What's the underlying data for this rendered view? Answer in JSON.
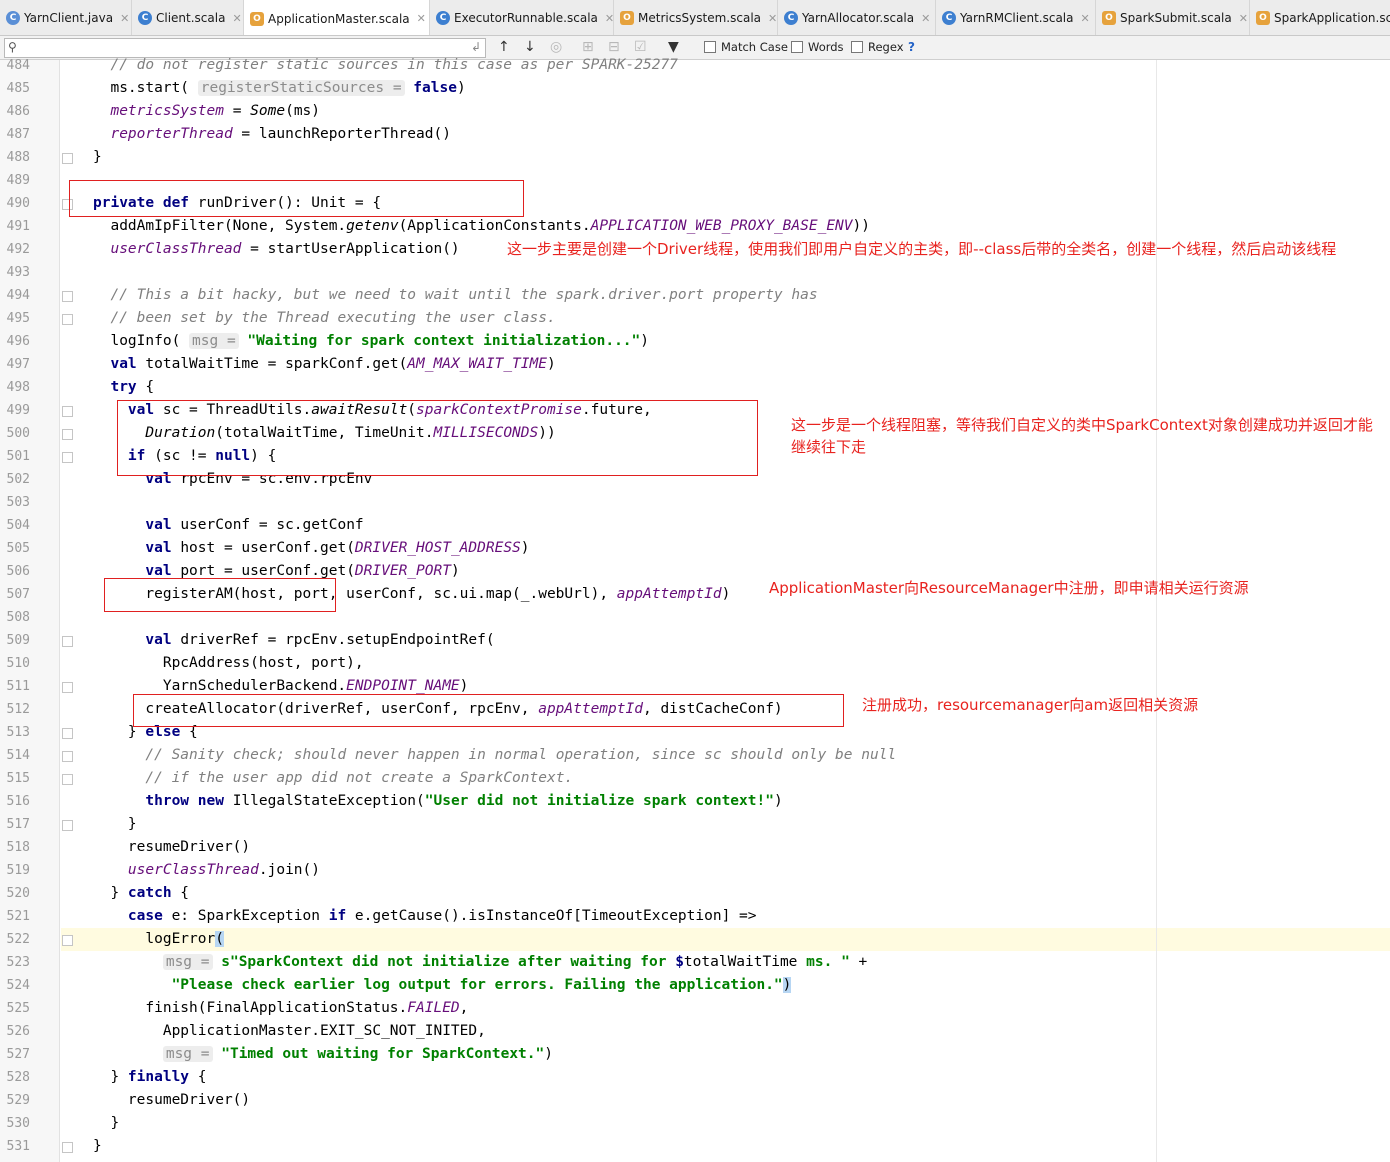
{
  "tabs": [
    {
      "label": "YarnClient.java",
      "icon": "java-class-icon",
      "active": false
    },
    {
      "label": "Client.scala",
      "icon": "scala-class-icon",
      "active": false
    },
    {
      "label": "ApplicationMaster.scala",
      "icon": "scala-object-icon",
      "active": true
    },
    {
      "label": "ExecutorRunnable.scala",
      "icon": "scala-class-icon",
      "active": false
    },
    {
      "label": "MetricsSystem.scala",
      "icon": "scala-object-icon",
      "active": false
    },
    {
      "label": "YarnAllocator.scala",
      "icon": "scala-class-icon",
      "active": false
    },
    {
      "label": "YarnRMClient.scala",
      "icon": "scala-class-icon",
      "active": false
    },
    {
      "label": "SparkSubmit.scala",
      "icon": "scala-object-icon",
      "active": false
    },
    {
      "label": "SparkApplication.sca",
      "icon": "scala-object-icon",
      "active": false
    }
  ],
  "search": {
    "value": "",
    "placeholder": "",
    "options": {
      "match_case": "Match Case",
      "words": "Words",
      "regex": "Regex",
      "help": "?"
    }
  },
  "editor": {
    "caret_line": "522",
    "lines": [
      {
        "n": "484",
        "html": "  <span class=\"cm\">// do not register static sources in this case as per SPARK-25277</span>"
      },
      {
        "n": "485",
        "html": "  ms.start( <span class=\"hint\">registerStaticSources =</span> <span class=\"kw\">false</span>)"
      },
      {
        "n": "486",
        "html": "  <span class=\"fld\">metricsSystem</span> = <span class=\"it\">Some</span>(ms)"
      },
      {
        "n": "487",
        "html": "  <span class=\"fld\">reporterThread</span> = launchReporterThread()"
      },
      {
        "n": "488",
        "html": "}",
        "fold": true
      },
      {
        "n": "489",
        "html": ""
      },
      {
        "n": "490",
        "html": "<span class=\"kw\">private def</span> runDriver(): Unit = {",
        "fold": true
      },
      {
        "n": "491",
        "html": "  addAmIpFilter(None, System.<span class=\"it\">getenv</span>(ApplicationConstants.<span class=\"fld\">APPLICATION_WEB_PROXY_BASE_ENV</span>))"
      },
      {
        "n": "492",
        "html": "  <span class=\"fld\">userClassThread</span> = startUserApplication()"
      },
      {
        "n": "493",
        "html": ""
      },
      {
        "n": "494",
        "html": "  <span class=\"cm\">// This a bit hacky, but we need to wait until the spark.driver.port property has</span>",
        "fold": true
      },
      {
        "n": "495",
        "html": "  <span class=\"cm\">// been set by the Thread executing the user class.</span>",
        "fold": true
      },
      {
        "n": "496",
        "html": "  logInfo( <span class=\"hint\">msg =</span> <span class=\"str\">\"Waiting for spark context initialization...\"</span>)"
      },
      {
        "n": "497",
        "html": "  <span class=\"kw\">val</span> totalWaitTime = sparkConf.get(<span class=\"fld\">AM_MAX_WAIT_TIME</span>)"
      },
      {
        "n": "498",
        "html": "  <span class=\"kw\">try</span> {"
      },
      {
        "n": "499",
        "html": "    <span class=\"kw\">val</span> sc = ThreadUtils.<span class=\"it\">awaitResult</span>(<span class=\"fld\">sparkContextPromise</span>.future,",
        "fold": true
      },
      {
        "n": "500",
        "html": "      <span class=\"it\">Duration</span>(totalWaitTime, TimeUnit.<span class=\"fld\">MILLISECONDS</span>))",
        "fold": true
      },
      {
        "n": "501",
        "html": "    <span class=\"kw\">if</span> (sc != <span class=\"kw\">null</span>) {",
        "fold": true
      },
      {
        "n": "502",
        "html": "      <span class=\"kw\">val</span> rpcEnv = sc.env.rpcEnv"
      },
      {
        "n": "503",
        "html": ""
      },
      {
        "n": "504",
        "html": "      <span class=\"kw\">val</span> userConf = sc.getConf"
      },
      {
        "n": "505",
        "html": "      <span class=\"kw\">val</span> host = userConf.get(<span class=\"fld\">DRIVER_HOST_ADDRESS</span>)"
      },
      {
        "n": "506",
        "html": "      <span class=\"kw\">val</span> port = userConf.get(<span class=\"fld\">DRIVER_PORT</span>)"
      },
      {
        "n": "507",
        "html": "      registerAM(host, port, userConf, sc.ui.map(_.webUrl), <span class=\"fld\">appAttemptId</span>)"
      },
      {
        "n": "508",
        "html": ""
      },
      {
        "n": "509",
        "html": "      <span class=\"kw\">val</span> driverRef = rpcEnv.setupEndpointRef(",
        "fold": true
      },
      {
        "n": "510",
        "html": "        RpcAddress(host, port),"
      },
      {
        "n": "511",
        "html": "        YarnSchedulerBackend.<span class=\"fld\">ENDPOINT_NAME</span>)",
        "fold": true
      },
      {
        "n": "512",
        "html": "      createAllocator(driverRef, userConf, rpcEnv, <span class=\"fld\">appAttemptId</span>, distCacheConf)"
      },
      {
        "n": "513",
        "html": "    } <span class=\"kw\">else</span> {",
        "fold": true
      },
      {
        "n": "514",
        "html": "      <span class=\"cm\">// Sanity check; should never happen in normal operation, since sc should only be null</span>",
        "fold": true
      },
      {
        "n": "515",
        "html": "      <span class=\"cm\">// if the user app did not create a SparkContext.</span>",
        "fold": true
      },
      {
        "n": "516",
        "html": "      <span class=\"kw\">throw new</span> IllegalStateException(<span class=\"str\">\"User did not initialize spark context!\"</span>)"
      },
      {
        "n": "517",
        "html": "    }",
        "fold": true
      },
      {
        "n": "518",
        "html": "    resumeDriver()"
      },
      {
        "n": "519",
        "html": "    <span class=\"fld\">userClassThread</span>.join()"
      },
      {
        "n": "520",
        "html": "  } <span class=\"kw\">catch</span> {"
      },
      {
        "n": "521",
        "html": "    <span class=\"kw\">case</span> e: SparkException <span class=\"kw\">if</span> e.getCause().isInstanceOf[TimeoutException] =&gt;"
      },
      {
        "n": "522",
        "html": "      logError<span class=\"bracket-hl\">(</span>",
        "fold": true
      },
      {
        "n": "523",
        "html": "        <span class=\"hint\">msg =</span> <span class=\"str\">s\"SparkContext did not initialize after waiting for </span><span class=\"kw\">$</span>totalWaitTime<span class=\"str\"> ms. \"</span> +"
      },
      {
        "n": "524",
        "html": "         <span class=\"str\">\"Please check earlier log output for errors. Failing the application.\"</span><span class=\"bracket-hl\">)</span>"
      },
      {
        "n": "525",
        "html": "      finish(FinalApplicationStatus.<span class=\"fld\">FAILED</span>,"
      },
      {
        "n": "526",
        "html": "        ApplicationMaster.EXIT_SC_NOT_INITED,"
      },
      {
        "n": "527",
        "html": "        <span class=\"hint\">msg =</span> <span class=\"str\">\"Timed out waiting for SparkContext.\"</span>)"
      },
      {
        "n": "528",
        "html": "  } <span class=\"kw\">finally</span> {"
      },
      {
        "n": "529",
        "html": "    resumeDriver()"
      },
      {
        "n": "530",
        "html": "  }"
      },
      {
        "n": "531",
        "html": "}",
        "fold": true
      }
    ]
  },
  "annotations": [
    {
      "id": "note-create-driver-thread",
      "text": "这一步主要是创建一个Driver线程，使用我们即用户自定义的主类，即--class后带的全类名，创建一个线程，然后启动该线程"
    },
    {
      "id": "note-wait-sparkcontext",
      "text": "这一步是一个线程阻塞，等待我们自定义的类中SparkContext对象创建成功并返回才能继续往下走"
    },
    {
      "id": "note-register-am",
      "text": "ApplicationMaster向ResourceManager中注册，即申请相关运行资源"
    },
    {
      "id": "note-allocator",
      "text": "注册成功，resourcemanager向am返回相关资源"
    }
  ],
  "colors": {
    "annotation": "#e8231f",
    "keyword": "#000080",
    "string": "#008000",
    "field": "#660e7a",
    "comment": "#808080"
  }
}
